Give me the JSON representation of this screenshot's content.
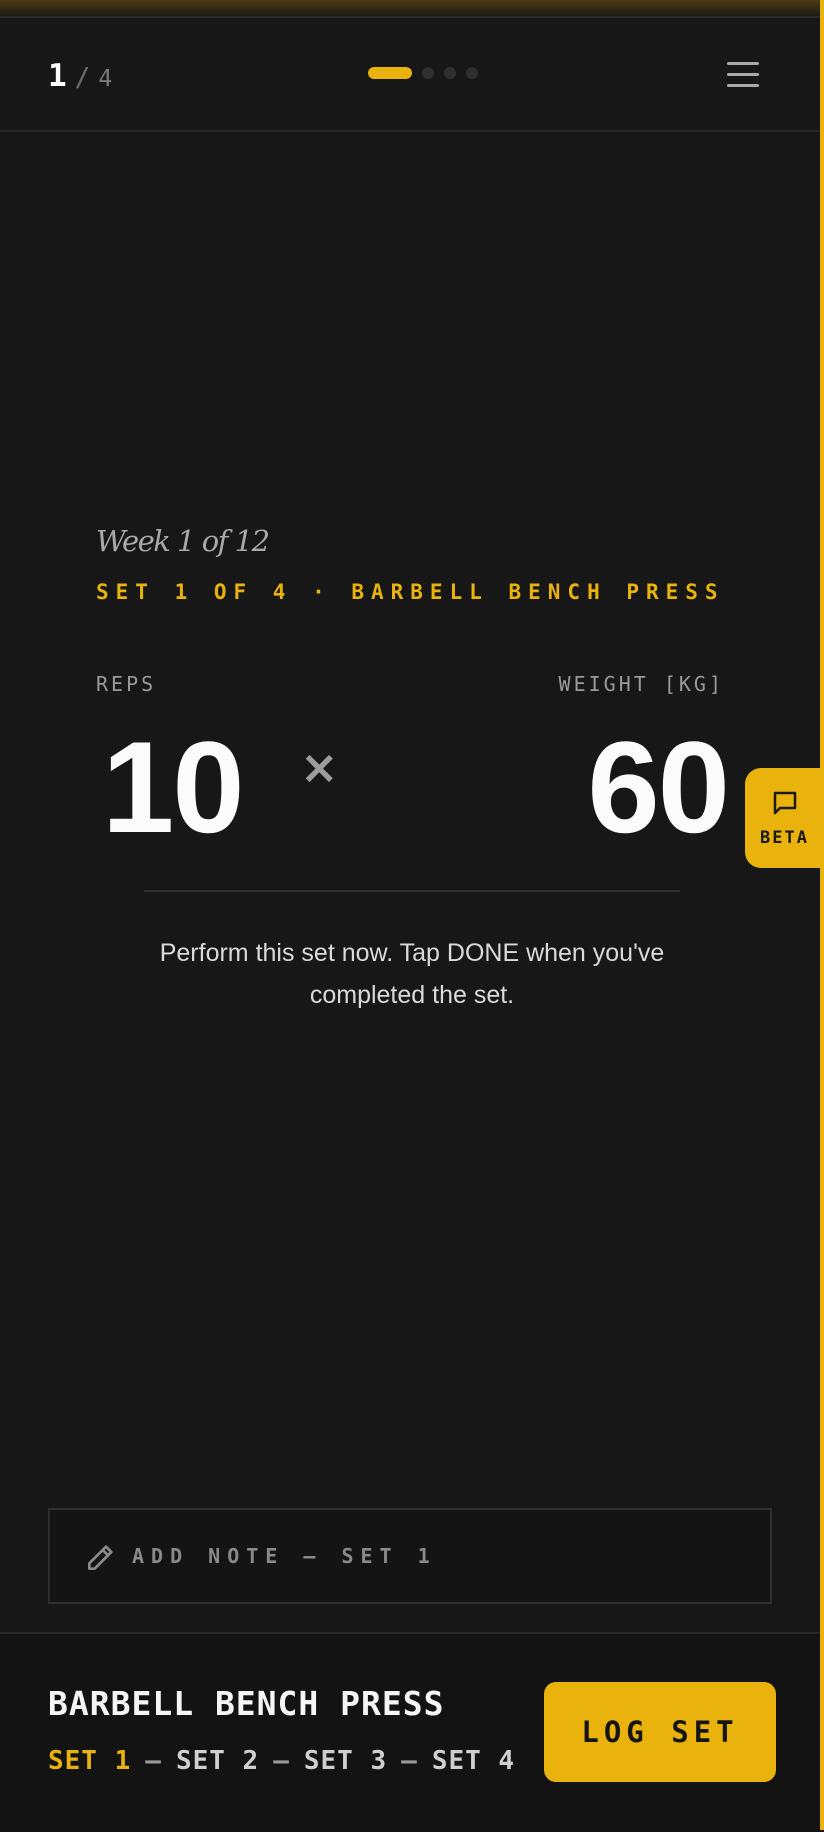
{
  "header": {
    "current_step": "1",
    "separator": "/",
    "total_steps": "4",
    "progress": {
      "active_index": 0,
      "count": 4
    }
  },
  "session": {
    "week_label": "Week 1 of 12",
    "set_line": "SET 1 OF 4 · BARBELL BENCH PRESS",
    "reps_label": "REPS",
    "reps_value": "10",
    "times_symbol": "×",
    "weight_label": "WEIGHT [KG]",
    "weight_value": "60",
    "instruction": "Perform this set now. Tap DONE when you've completed the set."
  },
  "beta": {
    "label": "BETA"
  },
  "note": {
    "label": "ADD NOTE — SET 1"
  },
  "footer": {
    "exercise_name": "BARBELL BENCH PRESS",
    "sets": [
      "SET 1",
      "SET 2",
      "SET 3",
      "SET 4"
    ],
    "dash": "—",
    "log_button": "LOG SET"
  },
  "colors": {
    "accent": "#e9b20c",
    "background": "#171717"
  }
}
